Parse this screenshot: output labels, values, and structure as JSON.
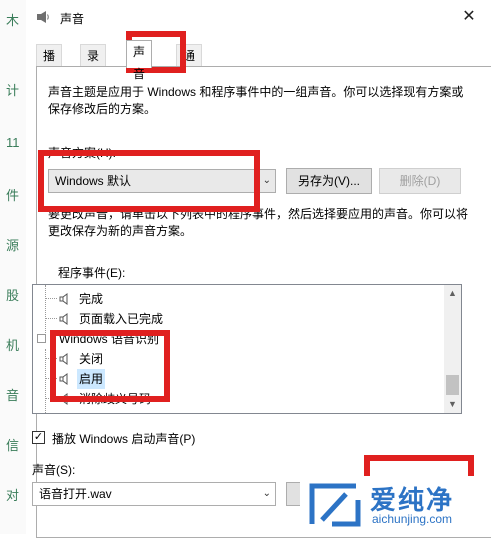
{
  "left_strip": [
    "木",
    "计",
    "11",
    "件",
    "源",
    "股",
    "机",
    "音",
    "信",
    "对"
  ],
  "window": {
    "title": "声音",
    "close_label": "✕"
  },
  "tabs": [
    {
      "label": "播放"
    },
    {
      "label": "录制"
    },
    {
      "label": "声音",
      "active": true
    },
    {
      "label": "通信"
    }
  ],
  "description": "声音主题是应用于 Windows 和程序事件中的一组声音。你可以选择现有方案或保存修改后的方案。",
  "scheme": {
    "label": "声音方案(H):",
    "value": "Windows 默认",
    "save_as_label": "另存为(V)...",
    "delete_label": "删除(D)"
  },
  "instructions": "要更改声音，请单击以下列表中的程序事件，然后选择要应用的声音。你可以将更改保存为新的声音方案。",
  "events": {
    "label": "程序事件(E):",
    "items": [
      {
        "text": "完成"
      },
      {
        "text": "页面载入已完成"
      },
      {
        "text": "Windows 语音识别"
      },
      {
        "text": "关闭"
      },
      {
        "text": "启用",
        "selected": true
      },
      {
        "text": "消除歧义号码"
      }
    ]
  },
  "startup": {
    "checked": true,
    "label": "播放 Windows 启动声音(P)"
  },
  "sounds": {
    "label": "声音(S):",
    "value": "语音打开.wav"
  },
  "watermark": {
    "text": "爱纯净",
    "sub": "aichunjing.com"
  },
  "colors": {
    "highlight": "#e0201f",
    "selection": "#cce8ff",
    "brand": "#2c73c5"
  }
}
